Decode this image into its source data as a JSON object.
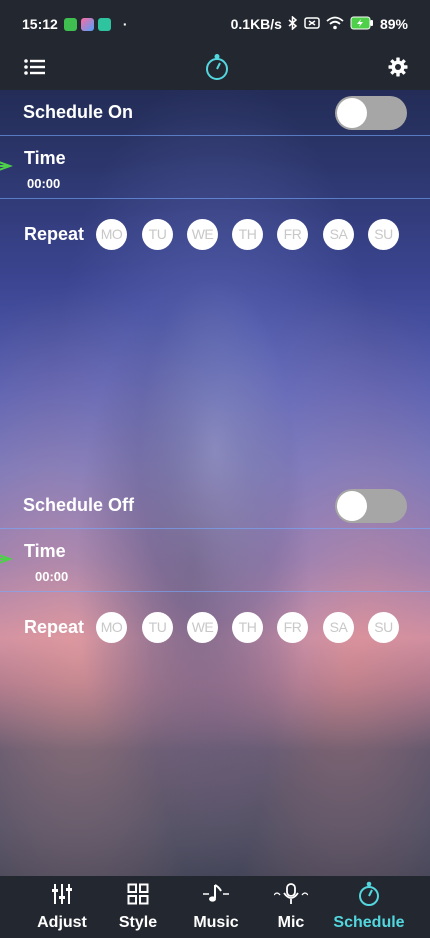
{
  "status_bar": {
    "time": "15:12",
    "separator": "·",
    "speed": "0.1KB/s",
    "battery": "89%"
  },
  "top_bar": {
    "menu_icon": "list-icon",
    "center_icon": "timer-icon",
    "settings_icon": "gear-icon"
  },
  "schedule_on": {
    "label": "Schedule On",
    "enabled": false,
    "time_label": "Time",
    "time_value": "00:00",
    "repeat_label": "Repeat",
    "days": [
      "MO",
      "TU",
      "WE",
      "TH",
      "FR",
      "SA",
      "SU"
    ]
  },
  "schedule_off": {
    "label": "Schedule Off",
    "enabled": false,
    "time_label": "Time",
    "time_value": "00:00",
    "repeat_label": "Repeat",
    "days": [
      "MO",
      "TU",
      "WE",
      "TH",
      "FR",
      "SA",
      "SU"
    ]
  },
  "tabs": [
    {
      "label": "Adjust",
      "icon": "sliders-icon"
    },
    {
      "label": "Style",
      "icon": "grid-icon"
    },
    {
      "label": "Music",
      "icon": "music-note-icon"
    },
    {
      "label": "Mic",
      "icon": "microphone-icon"
    },
    {
      "label": "Schedule",
      "icon": "timer-icon"
    }
  ],
  "colors": {
    "accent": "#53d7df",
    "bar_bg": "#23272f",
    "divider": "#78aaff",
    "arrow": "#4ed04a"
  }
}
